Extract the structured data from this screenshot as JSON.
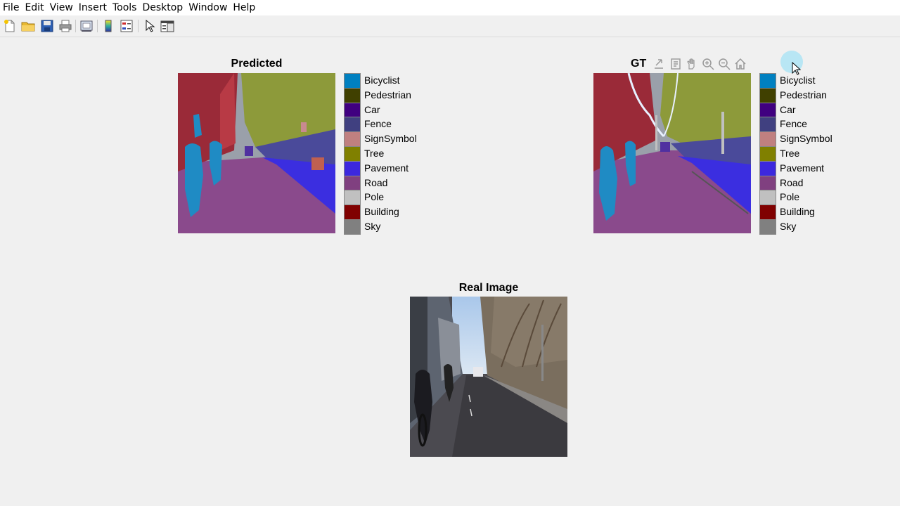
{
  "menu": [
    "File",
    "Edit",
    "View",
    "Insert",
    "Tools",
    "Desktop",
    "Window",
    "Help"
  ],
  "toolbar": {
    "icons": [
      "new-figure-icon",
      "open-file-icon",
      "save-icon",
      "print-icon",
      "print-preview-icon",
      "colorbar-icon",
      "legend-icon",
      "pointer-icon",
      "property-editor-icon"
    ]
  },
  "axes_toolbar": [
    "export-icon",
    "data-tips-icon",
    "pan-icon",
    "zoom-in-icon",
    "zoom-out-icon",
    "home-icon"
  ],
  "panels": {
    "predicted": {
      "title": "Predicted"
    },
    "gt": {
      "title": "GT"
    },
    "real": {
      "title": "Real Image"
    }
  },
  "legend": [
    {
      "label": "Bicyclist",
      "color": "#0080c0"
    },
    {
      "label": "Pedestrian",
      "color": "#404000"
    },
    {
      "label": "Car",
      "color": "#400080"
    },
    {
      "label": "Fence",
      "color": "#404080"
    },
    {
      "label": "SignSymbol",
      "color": "#c08080"
    },
    {
      "label": "Tree",
      "color": "#808000"
    },
    {
      "label": "Pavement",
      "color": "#3c28de"
    },
    {
      "label": "Road",
      "color": "#804080"
    },
    {
      "label": "Pole",
      "color": "#c0c0c0"
    },
    {
      "label": "Building",
      "color": "#800000"
    },
    {
      "label": "Sky",
      "color": "#808080"
    }
  ]
}
